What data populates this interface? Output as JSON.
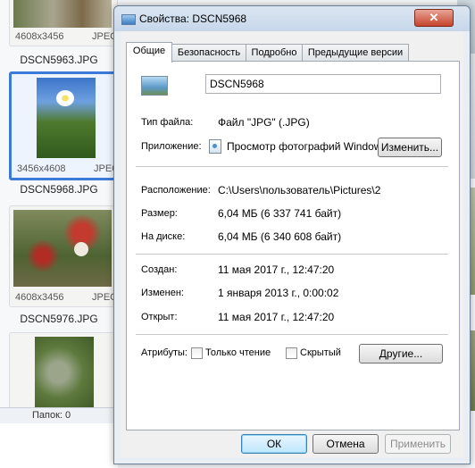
{
  "explorer": {
    "tiles": [
      {
        "dims": "4608x3456",
        "format": "JPEG",
        "name": "DSCN5963.JPG"
      },
      {
        "dims": "3456x4608",
        "format": "JPEG",
        "name": "DSCN5968.JPG"
      },
      {
        "dims": "4608x3456",
        "format": "JPEG",
        "name": "DSCN5976.JPG"
      }
    ],
    "status": "Папок: 0"
  },
  "dialog": {
    "title": "Свойства: DSCN5968",
    "close_glyph": "✕",
    "tabs": [
      "Общие",
      "Безопасность",
      "Подробно",
      "Предыдущие версии"
    ],
    "file_name": "DSCN5968",
    "file_type_label": "Тип файла:",
    "file_type_value": "Файл \"JPG\" (.JPG)",
    "app_label": "Приложение:",
    "app_value": "Просмотр фотографий Windows",
    "change_button": "Изменить...",
    "location_label": "Расположение:",
    "location_value": "C:\\Users\\пользователь\\Pictures\\2",
    "size_label": "Размер:",
    "size_value": "6,04 МБ (6 337 741 байт)",
    "disk_label": "На диске:",
    "disk_value": "6,04 МБ (6 340 608 байт)",
    "created_label": "Создан:",
    "created_value": "11 мая 2017 г., 12:47:20",
    "modified_label": "Изменен:",
    "modified_value": "1 января 2013 г., 0:00:02",
    "opened_label": "Открыт:",
    "opened_value": "11 мая 2017 г., 12:47:20",
    "attributes_label": "Атрибуты:",
    "readonly_label": "Только чтение",
    "hidden_label": "Скрытый",
    "other_button": "Другие...",
    "ok_button": "ОК",
    "cancel_button": "Отмена",
    "apply_button": "Применить"
  }
}
